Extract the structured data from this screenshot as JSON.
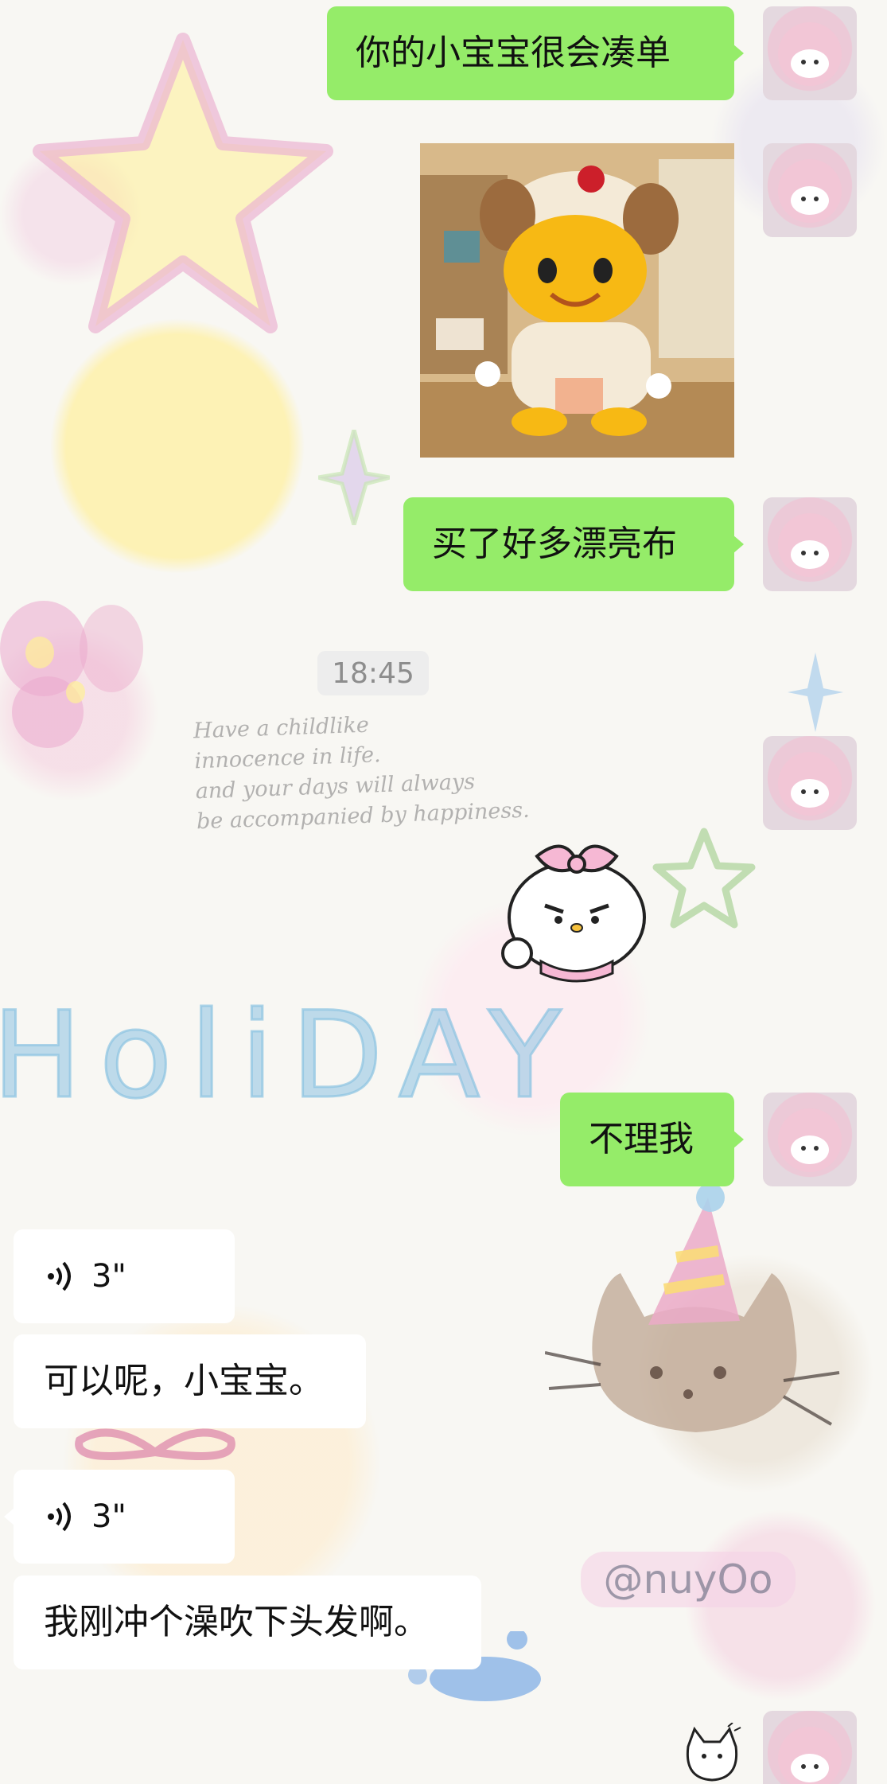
{
  "background": {
    "note_text": "Have a childlike\ninnocence in life.\nand your days will always\nbe accompanied by happiness.",
    "title_text": "HoliDAY",
    "handle_text": "@nuyOo"
  },
  "messages": [
    {
      "type": "text",
      "direction": "out",
      "text": "你的小宝宝很会凑单"
    },
    {
      "type": "image",
      "direction": "out",
      "alt": "puppy"
    },
    {
      "type": "text",
      "direction": "out",
      "text": "买了好多漂亮布"
    },
    {
      "type": "timestamp",
      "text": "18:45"
    },
    {
      "type": "sticker",
      "direction": "out"
    },
    {
      "type": "text",
      "direction": "out",
      "text": "不理我"
    },
    {
      "type": "voice",
      "direction": "in",
      "duration": "3\""
    },
    {
      "type": "text",
      "direction": "in",
      "text": "可以呢，小宝宝。"
    },
    {
      "type": "voice",
      "direction": "in",
      "duration": "3\""
    },
    {
      "type": "text",
      "direction": "in",
      "text": "我刚冲个澡吹下头发啊。"
    },
    {
      "type": "sticker",
      "direction": "out"
    }
  ],
  "colors": {
    "outgoing_bubble": "#95ec69",
    "incoming_bubble": "#ffffff",
    "timestamp_text": "#8d8d8d"
  }
}
